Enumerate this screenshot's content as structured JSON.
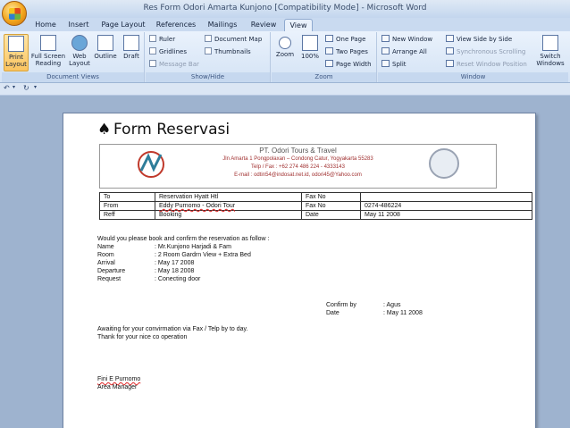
{
  "window": {
    "title": "Res Form Odori Amarta Kunjono [Compatibility Mode] - Microsoft Word"
  },
  "tabs": [
    "Home",
    "Insert",
    "Page Layout",
    "References",
    "Mailings",
    "Review",
    "View"
  ],
  "ribbon": {
    "document_views": {
      "label": "Document Views",
      "print_layout": "Print Layout",
      "full_screen_reading": "Full Screen Reading",
      "web_layout": "Web Layout",
      "outline": "Outline",
      "draft": "Draft"
    },
    "show_hide": {
      "label": "Show/Hide",
      "ruler": "Ruler",
      "gridlines": "Gridlines",
      "message_bar": "Message Bar",
      "document_map": "Document Map",
      "thumbnails": "Thumbnails"
    },
    "zoom": {
      "label": "Zoom",
      "zoom": "Zoom",
      "hundred": "100%",
      "one_page": "One Page",
      "two_pages": "Two Pages",
      "page_width": "Page Width"
    },
    "window": {
      "label": "Window",
      "new_window": "New Window",
      "arrange_all": "Arrange All",
      "split": "Split",
      "view_side_by_side": "View Side by Side",
      "synchronous_scrolling": "Synchronous Scrolling",
      "reset_window_position": "Reset Window Position",
      "switch_windows": "Switch Windows"
    }
  },
  "document": {
    "heading": "Form Reservasi",
    "letterhead": {
      "company": "PT. Odori Tours & Travel",
      "address": "Jln Amarta 1 Pongpolaxan – Condong Catur, Yogyakarta 55283",
      "phone": "Telp / Fax :  +62 274 486 224 - 4333143",
      "email": "E-mail : odtin54@indosat.net.id, odori45@Yahoo.com"
    },
    "table": [
      [
        "To",
        "Reservation Hyatt Htl",
        "Fax No",
        ""
      ],
      [
        "From",
        "Eddy Purnomo - Odori Tour",
        "Fax No",
        "0274-486224"
      ],
      [
        "Reff",
        "Booking",
        "Date",
        "May 11 2008"
      ]
    ],
    "intro": "Would you please book and confirm the reservation as follow   :",
    "fields": [
      {
        "k": "Name",
        "v": ": Mr.Kunjono Harjadi & Fam"
      },
      {
        "k": "Room",
        "v": ": 2 Room Gardrn View + Extra Bed"
      },
      {
        "k": "Arrival",
        "v": ": May 17 2008"
      },
      {
        "k": "Departure",
        "v": ": May 18 2008"
      },
      {
        "k": "Request",
        "v": ": Conecting door"
      }
    ],
    "confirm": [
      {
        "k": "Confirm by",
        "v": ": Agus"
      },
      {
        "k": "Date",
        "v": ": May 11 2008"
      }
    ],
    "closing_1": "Awaiting for your convirmation via Fax / Telp by to day.",
    "closing_2": "Thank for your nice co operation",
    "signer_name": "Fini E Purnomo",
    "signer_title": "Area Manager"
  }
}
